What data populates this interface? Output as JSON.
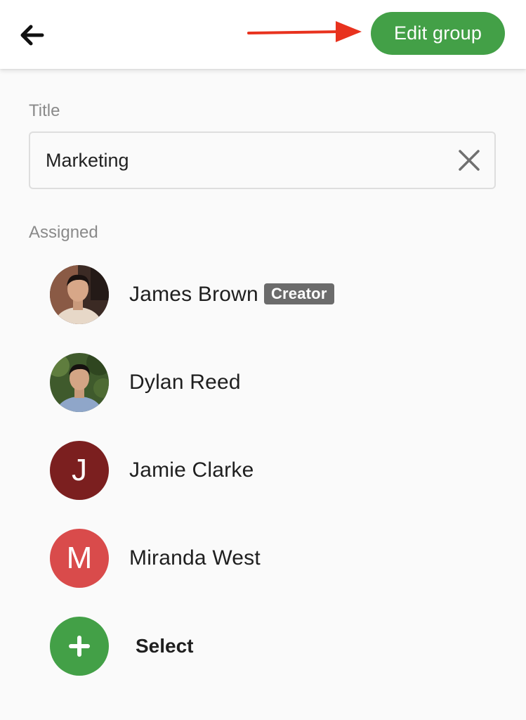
{
  "appbar": {
    "back_icon": "arrow-left-icon",
    "edit_button_label": "Edit group",
    "annotation_icon": "red-arrow-pointer-icon"
  },
  "form": {
    "title_label": "Title",
    "title_value": "Marketing",
    "clear_icon": "close-icon",
    "assigned_label": "Assigned"
  },
  "members": [
    {
      "name": "James Brown",
      "badge": "Creator",
      "avatar": "photo"
    },
    {
      "name": "Dylan Reed",
      "avatar": "photo"
    },
    {
      "name": "Jamie Clarke",
      "initial": "J",
      "avatar_color": "#7b1f1f"
    },
    {
      "name": "Miranda West",
      "initial": "M",
      "avatar_color": "#d94b4b"
    }
  ],
  "select": {
    "label": "Select",
    "icon": "plus-icon",
    "color": "#43a047"
  },
  "colors": {
    "accent": "#43a047",
    "annotation": "#e8321e"
  }
}
